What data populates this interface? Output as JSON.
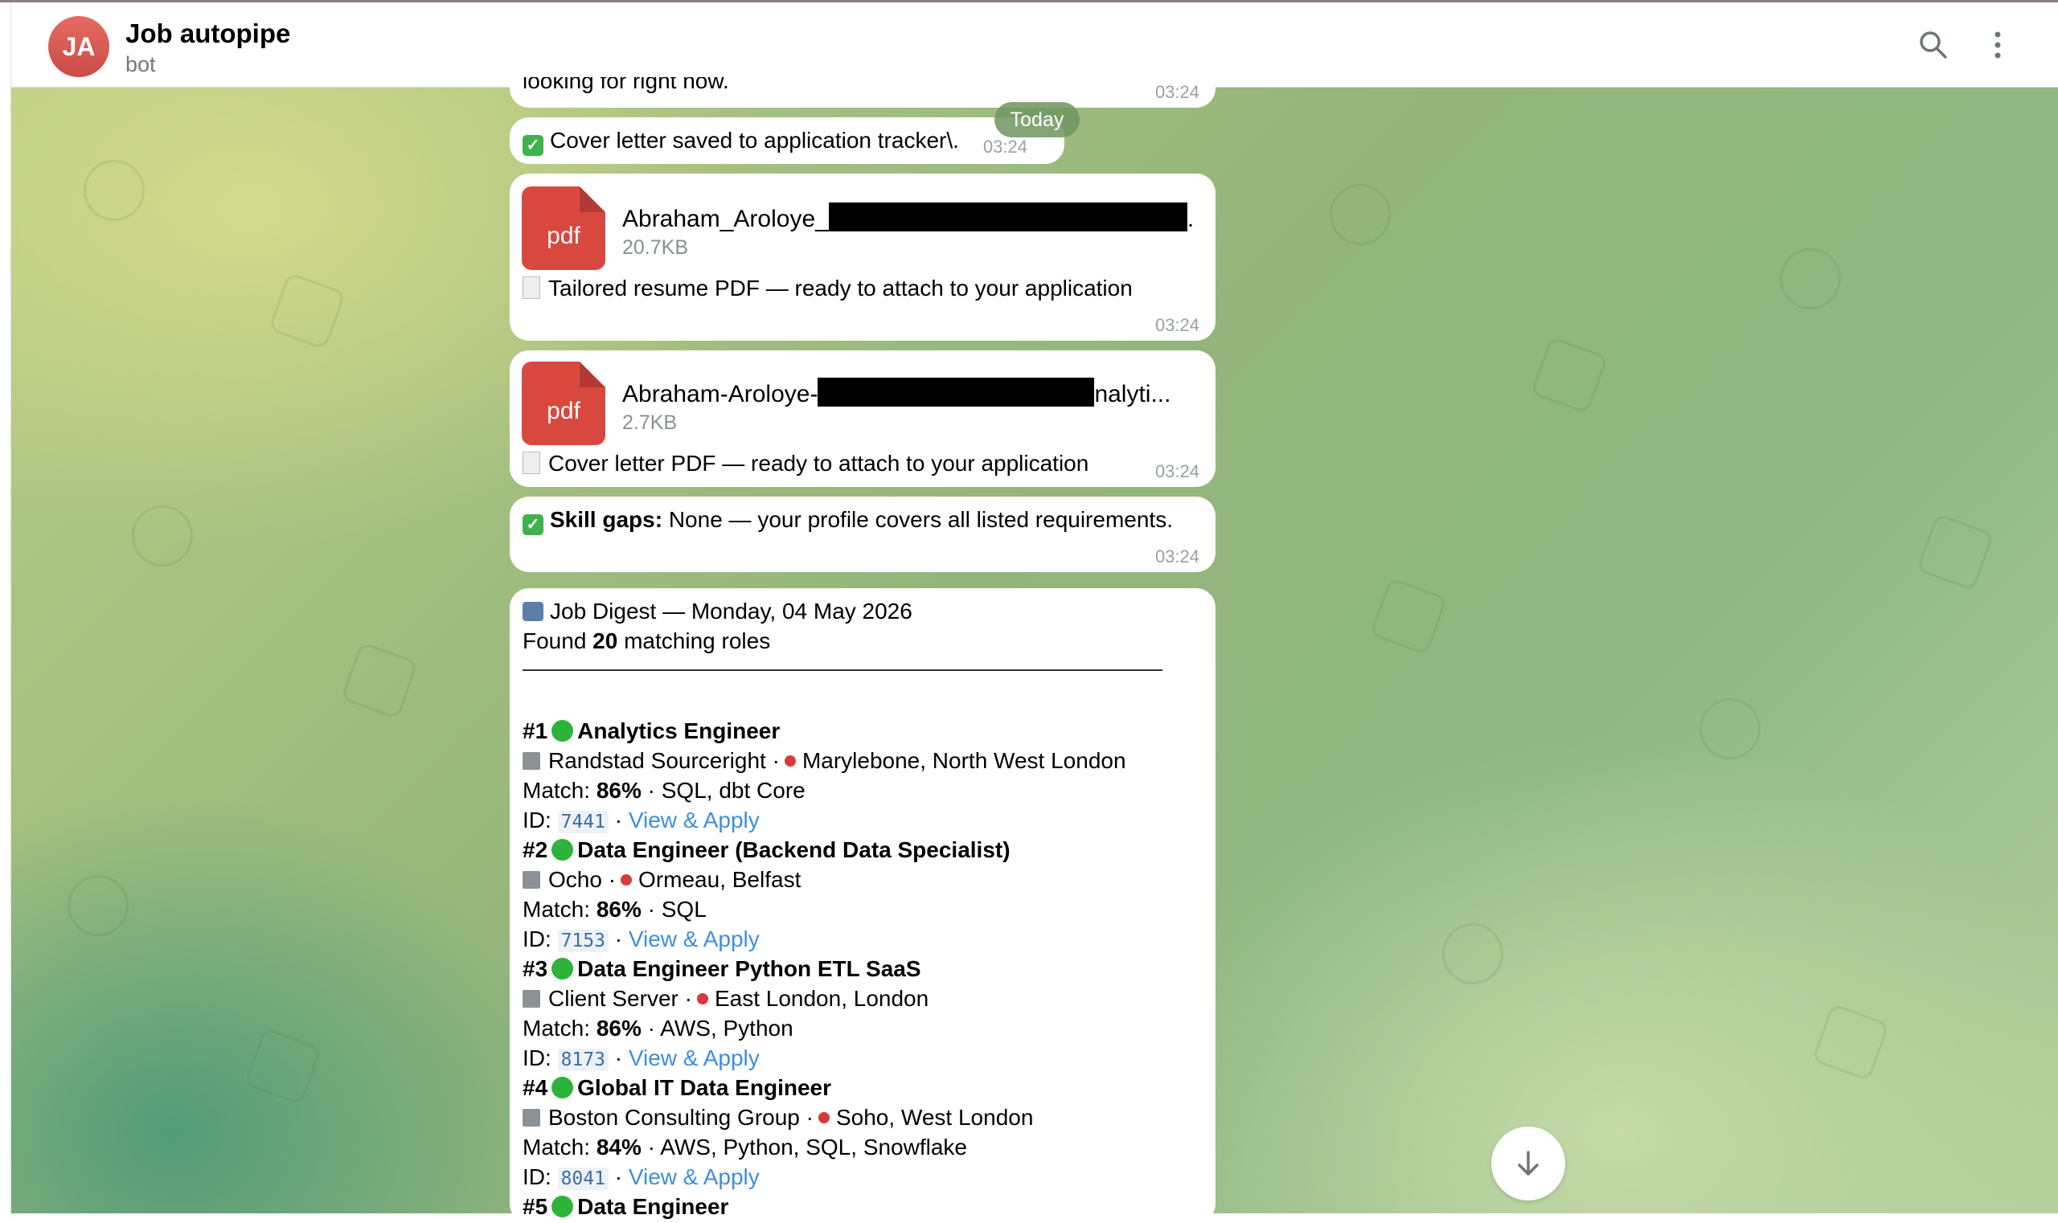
{
  "header": {
    "avatar_initials": "JA",
    "title": "Job autopipe",
    "subtitle": "bot",
    "search_icon": "search-icon",
    "menu_icon": "more-vertical-icon"
  },
  "date_pill": "Today",
  "messages": {
    "partial": {
      "text": "looking for right now.",
      "time": "03:24"
    },
    "cover_saved": {
      "text": "Cover letter saved to application tracker\\.",
      "time": "03:24"
    },
    "resume_file": {
      "icon_label": "pdf",
      "name_start": "Abraham_Aroloye_",
      "name_end": ".",
      "size": "20.7KB",
      "caption": "Tailored resume PDF — ready to attach to your application",
      "time": "03:24"
    },
    "cover_file": {
      "icon_label": "pdf",
      "name_start": "Abraham-Aroloye-",
      "name_end": "nalyti...",
      "size": "2.7KB",
      "caption": "Cover letter PDF — ready to attach to your application",
      "time": "03:24"
    },
    "skill_gaps": {
      "label": "Skill gaps:",
      "text": " None — your profile covers all listed requirements.",
      "time": "03:24"
    }
  },
  "digest": {
    "title": "Job Digest — Monday, 04 May 2026",
    "found_prefix": "Found ",
    "found_count": "20",
    "found_suffix": " matching roles",
    "jobs": [
      {
        "rank": "#1",
        "title": "Analytics Engineer",
        "company": "Randstad Sourceright",
        "location": "Marylebone, North West London",
        "match_label": "Match: ",
        "match": "86%",
        "skills": " · SQL, dbt Core",
        "id_label": "ID: ",
        "id": "7441",
        "link": "View & Apply"
      },
      {
        "rank": "#2",
        "title": "Data Engineer (Backend Data Specialist)",
        "company": "Ocho",
        "location": "Ormeau, Belfast",
        "match_label": "Match: ",
        "match": "86%",
        "skills": " · SQL",
        "id_label": "ID: ",
        "id": "7153",
        "link": "View & Apply"
      },
      {
        "rank": "#3",
        "title": "Data Engineer Python ETL SaaS",
        "company": "Client Server",
        "location": "East London, London",
        "match_label": "Match: ",
        "match": "86%",
        "skills": " · AWS, Python",
        "id_label": "ID: ",
        "id": "8173",
        "link": "View & Apply"
      },
      {
        "rank": "#4",
        "title": "Global IT Data Engineer",
        "company": "Boston Consulting Group",
        "location": "Soho, West London",
        "match_label": "Match: ",
        "match": "84%",
        "skills": " · AWS, Python, SQL, Snowflake",
        "id_label": "ID: ",
        "id": "8041",
        "link": "View & Apply"
      },
      {
        "rank": "#5",
        "title": "Data Engineer"
      }
    ]
  },
  "colors": {
    "accent_link": "#3d8ee0",
    "avatar": "#d9534f",
    "pdf": "#d9483f",
    "status_green": "#2db339"
  }
}
